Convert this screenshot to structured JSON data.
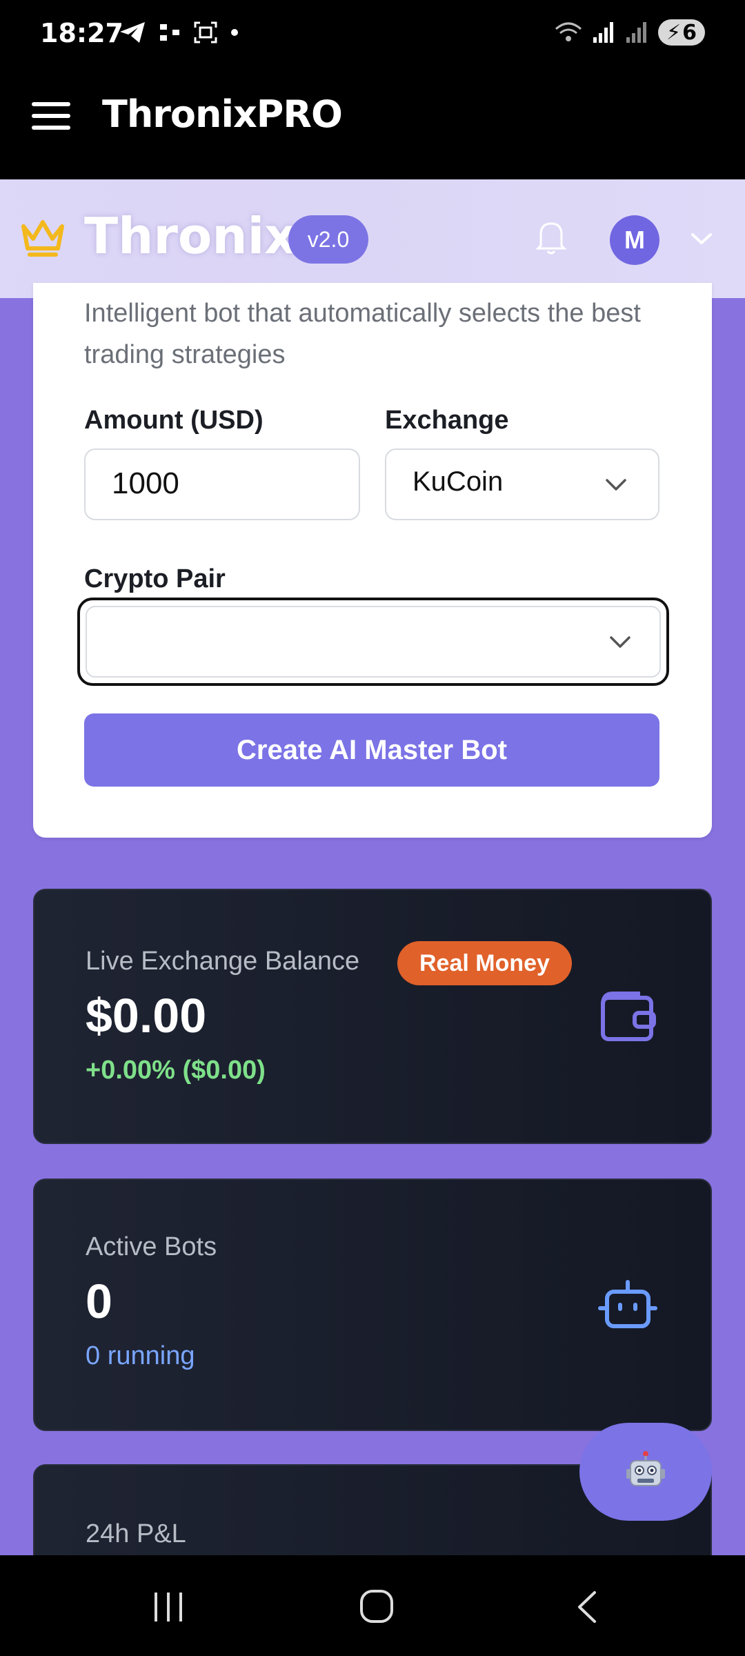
{
  "status_bar": {
    "time": "18:27",
    "battery": "6"
  },
  "app_bar": {
    "title": "ThronixPRO"
  },
  "header": {
    "brand": "Thronix",
    "version": "v2.0",
    "avatar_initial": "M"
  },
  "bot_form": {
    "subtitle": "Intelligent bot that automatically selects the best trading strategies",
    "amount_label": "Amount (USD)",
    "amount_value": "1000",
    "exchange_label": "Exchange",
    "exchange_value": "KuCoin",
    "pair_label": "Crypto Pair",
    "pair_value": "",
    "create_button": "Create AI Master Bot"
  },
  "balance_card": {
    "label": "Live Exchange Balance",
    "badge": "Real Money",
    "value": "$0.00",
    "change": "+0.00% ($0.00)",
    "icon": "wallet-icon"
  },
  "bots_card": {
    "label": "Active Bots",
    "value": "0",
    "sub": "0 running",
    "icon": "robot-icon"
  },
  "pnl_card": {
    "label": "24h P&L"
  },
  "colors": {
    "accent": "#7b73e6",
    "real_money": "#e0612a",
    "positive": "#7fe08a",
    "link": "#7aa6ff",
    "card_dark": "#1a1f2c"
  }
}
